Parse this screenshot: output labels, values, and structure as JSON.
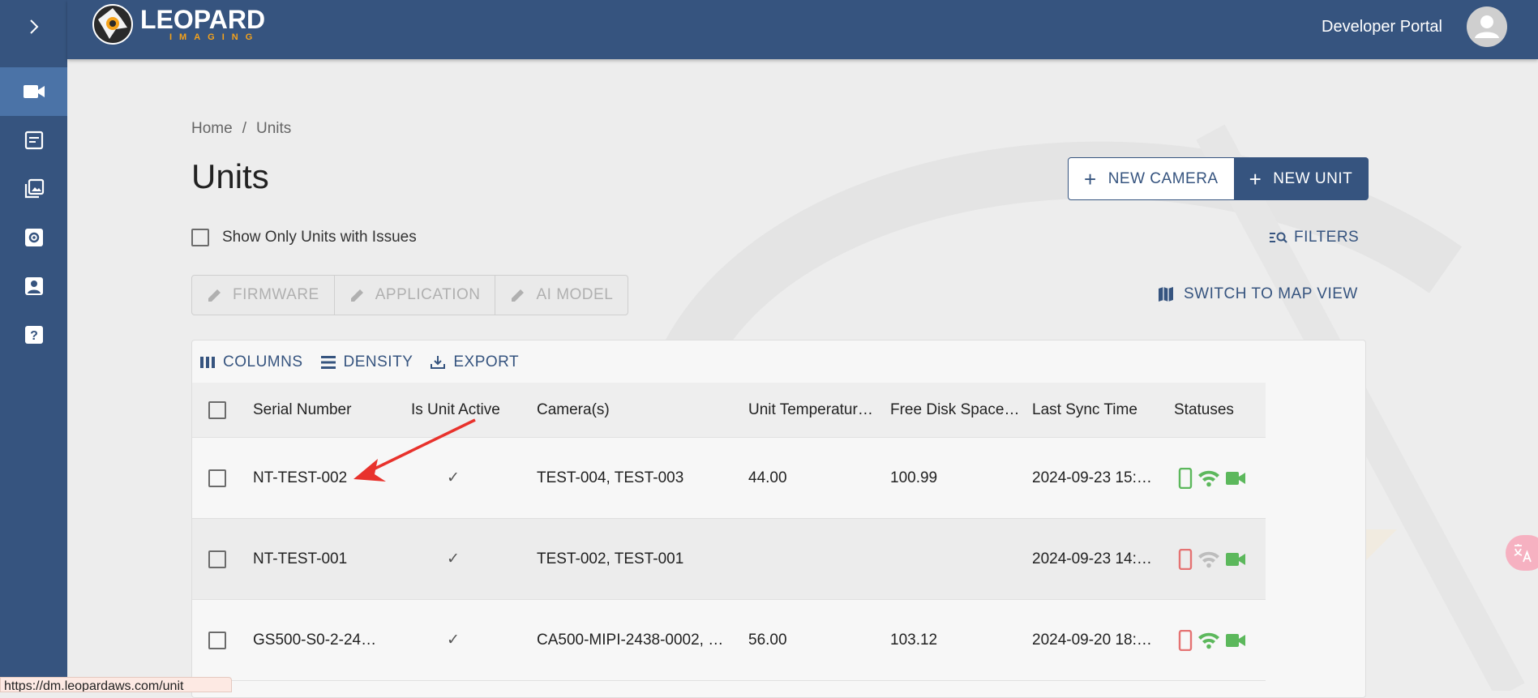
{
  "brand": {
    "name": "LEOPARD",
    "sub": "IMAGING"
  },
  "header": {
    "portal_label": "Developer Portal"
  },
  "sidebar": {
    "toggle_icon": "chevron-right-icon",
    "items": [
      {
        "name": "video-camera-icon",
        "active": true
      },
      {
        "name": "article-icon"
      },
      {
        "name": "photo-library-icon"
      },
      {
        "name": "settings-box-icon"
      },
      {
        "name": "contact-icon"
      },
      {
        "name": "help-icon"
      }
    ]
  },
  "breadcrumb": {
    "home": "Home",
    "separator": "/",
    "current": "Units"
  },
  "page": {
    "title": "Units"
  },
  "actions": {
    "new_camera": "NEW CAMERA",
    "new_unit": "NEW UNIT"
  },
  "issues_filter": {
    "label": "Show Only Units with Issues"
  },
  "filters_label": "FILTERS",
  "update_buttons": {
    "firmware": "FIRMWARE",
    "application": "APPLICATION",
    "ai_model": "AI MODEL"
  },
  "map_view_label": "SWITCH TO MAP VIEW",
  "grid_toolbar": {
    "columns": "COLUMNS",
    "density": "DENSITY",
    "export": "EXPORT"
  },
  "table": {
    "columns": [
      "Serial Number",
      "Is Unit Active",
      "Camera(s)",
      "Unit Temperatur…",
      "Free Disk Space…",
      "Last Sync Time",
      "Statuses"
    ],
    "rows": [
      {
        "serial": "NT-TEST-002",
        "active": "✓",
        "cameras": "TEST-004, TEST-003",
        "temp": "44.00",
        "disk": "100.99",
        "sync": "2024-09-23 15:…",
        "phone": "#5cb85c",
        "wifi": "#5cb85c",
        "camera": "#5cb85c"
      },
      {
        "serial": "NT-TEST-001",
        "active": "✓",
        "cameras": "TEST-002, TEST-001",
        "temp": "",
        "disk": "",
        "sync": "2024-09-23 14:…",
        "phone": "#e57373",
        "wifi": "#bdbdbd",
        "camera": "#5cb85c"
      },
      {
        "serial": "GS500-S0-2-24…",
        "active": "✓",
        "cameras": "CA500-MIPI-2438-0002, …",
        "temp": "56.00",
        "disk": "103.12",
        "sync": "2024-09-20 18:…",
        "phone": "#e57373",
        "wifi": "#5cb85c",
        "camera": "#5cb85c"
      }
    ]
  },
  "status_url": "https://dm.leopardaws.com/unit",
  "colors": {
    "primary": "#36547f",
    "sidebar_active": "#4b73a7",
    "accent": "#f5a21a",
    "ok": "#5cb85c",
    "error": "#e57373",
    "inactive": "#bdbdbd"
  }
}
